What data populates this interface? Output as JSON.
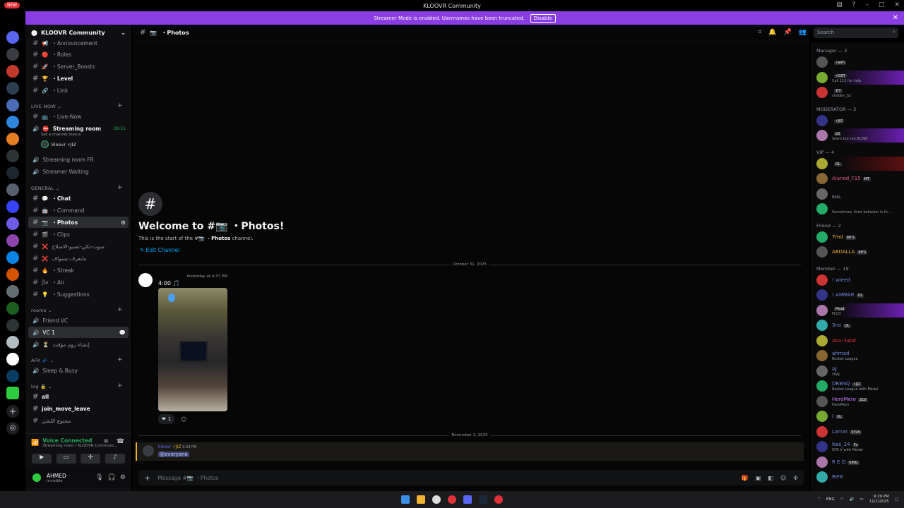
{
  "window": {
    "badge": "NEW",
    "title": "KLOOVR Community"
  },
  "banner": {
    "text": "Streamer Mode is enabled. Usernames have been truncated.",
    "disable_label": "Disable"
  },
  "guild": {
    "name": "KLOOVR Community"
  },
  "channels": {
    "top": [
      {
        "name": "・Announcement",
        "emoji": "📢"
      },
      {
        "name": "・Roles",
        "emoji": "🔴"
      },
      {
        "name": "・Server_Boosts",
        "emoji": "🚀"
      },
      {
        "name": "・Level",
        "emoji": "🏆"
      },
      {
        "name": "・Link",
        "emoji": "🔗"
      }
    ],
    "live_now_label": "LIVE NOW",
    "live_now": [
      {
        "name": "・Live-Now"
      },
      {
        "name": "Streaming room",
        "status": "Set a channel status",
        "time": "39:51"
      }
    ],
    "stream_user": "kloovr ⚡JIZ",
    "live_more": [
      {
        "name": "Streaming room FR"
      },
      {
        "name": "Streamer Waiting"
      }
    ],
    "general_label": "GENERAL",
    "general": [
      {
        "name": "・Chat",
        "emoji": "💬"
      },
      {
        "name": "・Command",
        "emoji": "🤖"
      },
      {
        "name": "・Photos",
        "emoji": "📷"
      },
      {
        "name": "・Clips",
        "emoji": "🎬"
      },
      {
        "name": "صوت-تكي-تصبو-الاصلاح",
        "emoji": "❌"
      },
      {
        "name": "مابعرف-يسواف",
        "emoji": "❌"
      },
      {
        "name": "・Streak",
        "emoji": "🔥"
      },
      {
        "name": "・Air",
        "emoji": "🌬"
      },
      {
        "name": "・Suggestions",
        "emoji": "💡"
      }
    ],
    "rooms_label": "rooms",
    "rooms": [
      {
        "name": "Friend VC"
      },
      {
        "name": "VC 1"
      },
      {
        "name": "إنشاء روم مؤقت"
      }
    ],
    "afk_label": "AFK 💤",
    "afk": [
      {
        "name": "Sleep & Busy"
      }
    ],
    "log_label": "log 🔒",
    "log": [
      {
        "name": "all"
      },
      {
        "name": "join_move_leave"
      },
      {
        "name": "مجتوع اللشن"
      }
    ]
  },
  "voice": {
    "status": "Voice Connected",
    "location": "Streaming room / KLOOVR Communi..."
  },
  "user": {
    "name": "AHMED",
    "status": "Invisible"
  },
  "chat": {
    "header": "・Photos",
    "search_placeholder": "Search",
    "welcome_title": "Welcome to #📷 ・Photos!",
    "welcome_sub_prefix": "This is the start of the #📷 ・",
    "welcome_sub_bold": "Photos",
    "welcome_sub_suffix": " channel.",
    "edit_channel": "Edit Channel",
    "date1": "October 31, 2025",
    "msg1_time": "Yesterday at 4:37 PM",
    "msg1_text": "4:00",
    "reaction_count": "1",
    "date2": "November 1, 2025",
    "msg2_author": "kloovr",
    "msg2_tag": "⚡JIZ",
    "msg2_time": "9:29 PM",
    "msg2_text": "@everyone",
    "input_placeholder": "Message #📷 ・Photos"
  },
  "members": {
    "groups": [
      {
        "label": "Manager — 3",
        "members": [
          {
            "name": "",
            "tag": "⚡alrh",
            "status": "",
            "color": "#f2f3f5"
          },
          {
            "name": "",
            "tag": "⚡OST",
            "status": "Call 111 for help",
            "color": "#f2f3f5",
            "bg": "purple"
          },
          {
            "name": "",
            "tag": "YJY",
            "status": "shaden_S2",
            "color": "#f2f3f5"
          }
        ]
      },
      {
        "label": "MODERATOR — 2",
        "members": [
          {
            "name": "",
            "tag": "⚡JIZ",
            "status": "",
            "color": "#f2f3f5"
          },
          {
            "name": "",
            "tag": "b0",
            "status": "Silent but not BLIND",
            "color": "#f2f3f5",
            "bg": "purple"
          }
        ]
      },
      {
        "label": "VIP — 4",
        "members": [
          {
            "name": "",
            "tag": "OL",
            "status": "",
            "color": "#e0303a",
            "bg": "red"
          },
          {
            "name": "Alanod_F15",
            "tag": "MT",
            "status": "",
            "color": "#e75a7c"
          },
          {
            "name": "",
            "tag": "",
            "status": "BRKL",
            "color": "#f2f3f5"
          },
          {
            "name": "",
            "tag": "",
            "status": "Sometimes, their behavior is th...",
            "color": "#f2f3f5"
          }
        ]
      },
      {
        "label": "Friend — 2",
        "members": [
          {
            "name": "7md",
            "tag": "88'S",
            "status": "",
            "color": "#f0b232"
          },
          {
            "name": "ABDALLA",
            "tag": "88'S",
            "status": "",
            "color": "#f0b232"
          }
        ]
      },
      {
        "label": "Member — 19",
        "members": [
          {
            "name": "! wleed",
            "tag": "",
            "status": "",
            "color": "#7289da"
          },
          {
            "name": "! AMMAR",
            "tag": "OL",
            "status": "",
            "color": "#7289da"
          },
          {
            "name": "",
            "tag": "Peud",
            "status": "PLO3",
            "color": "#f2f3f5",
            "bg": "purple"
          },
          {
            "name": "3rzi",
            "tag": "OL",
            "status": "",
            "color": "#7289da"
          },
          {
            "name": "Abu-3abd",
            "tag": "",
            "status": "",
            "color": "#e0303a"
          },
          {
            "name": "ahmad",
            "tag": "",
            "status": "Rocket League",
            "color": "#7289da"
          },
          {
            "name": "AJ",
            "tag": "",
            "status": "shAJ",
            "color": "#7289da"
          },
          {
            "name": "DRENQ",
            "tag": "⚡JIZ",
            "status": "Rocket League with Medal",
            "color": "#7289da"
          },
          {
            "name": "HeroMero",
            "tag": "ZLU",
            "status": "HeroMero",
            "color": "#c77dff"
          },
          {
            "name": "I",
            "tag": "OL",
            "status": "",
            "color": "#7289da"
          },
          {
            "name": "Lamar",
            "tag": "SYLN",
            "status": "",
            "color": "#7289da"
          },
          {
            "name": "Nas_24",
            "tag": "Fs",
            "status": "GTA V with Medal",
            "color": "#7289da"
          },
          {
            "name": "R E O",
            "tag": "KING",
            "status": "",
            "color": "#7289da"
          },
          {
            "name": "RIF8",
            "tag": "",
            "status": "",
            "color": "#7289da"
          }
        ]
      }
    ]
  },
  "tray": {
    "lang": "ENG",
    "time": "9:29 PM",
    "date": "11/1/2025"
  }
}
